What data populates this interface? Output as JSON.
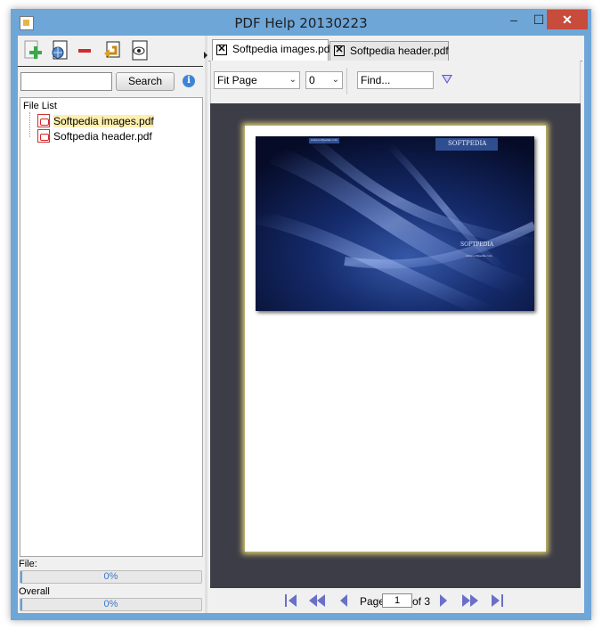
{
  "window": {
    "title": "PDF Help 20130223",
    "minimize_symbol": "–",
    "maximize_symbol": "☐",
    "close_symbol": "✕"
  },
  "toolbar": {
    "buttons": [
      {
        "name": "add-file",
        "icon": "add-document-icon"
      },
      {
        "name": "open-url",
        "icon": "globe-document-icon"
      },
      {
        "name": "remove-file",
        "icon": "remove-icon"
      },
      {
        "name": "back",
        "icon": "back-arrow-icon"
      },
      {
        "name": "view",
        "icon": "eye-document-icon"
      }
    ]
  },
  "search": {
    "value": "",
    "placeholder": "",
    "button_label": "Search",
    "info_symbol": "i"
  },
  "file_list": {
    "title": "File List",
    "items": [
      {
        "label": "Softpedia images.pdf",
        "selected": true
      },
      {
        "label": "Softpedia header.pdf",
        "selected": false
      }
    ]
  },
  "progress": {
    "file_label": "File:",
    "file_percent": "0%",
    "file_value": 0,
    "overall_label": "Overall",
    "overall_percent": "0%",
    "overall_value": 0
  },
  "tabs": [
    {
      "label": "Softpedia images.pdf",
      "active": true,
      "close_symbol": "✕"
    },
    {
      "label": "Softpedia header.pdf",
      "active": false,
      "close_symbol": "✕"
    }
  ],
  "viewer_toolbar": {
    "fit_mode": "Fit Page",
    "zoom_value": "0",
    "find_value": "Find...",
    "dropdown_symbol": "⌄"
  },
  "document": {
    "image_brand_top": "SOFTPEDIA",
    "image_brand_center": "SOFTPEDIA",
    "image_url_small": "www.softpedia.com",
    "image_url_bottom": "www.softpedia.com"
  },
  "navigation": {
    "page_label": "Page",
    "current_page": "1",
    "of_label": "of 3"
  },
  "colors": {
    "window_border": "#6ea6d8",
    "close_button": "#c74c3c",
    "viewer_background": "#3d3d48",
    "nav_arrows": "#6a6fc8",
    "progress_text": "#3a78c8"
  }
}
